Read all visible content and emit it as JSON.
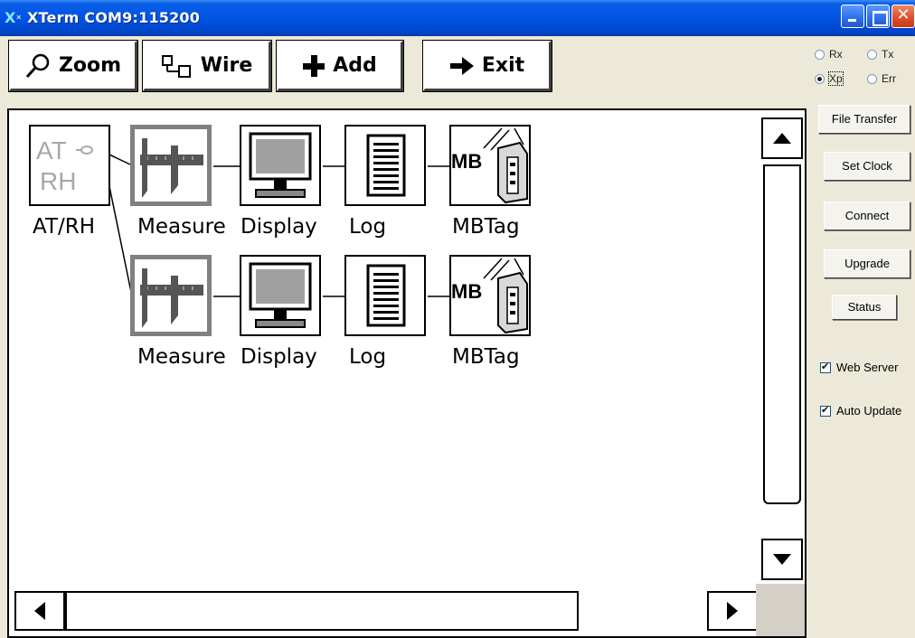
{
  "window": {
    "title": "XTerm COM9:115200",
    "icon": "xterm-icon",
    "icon_glyph": "X",
    "icon_sub": "✕",
    "close_glyph": "✕"
  },
  "toolbar": {
    "zoom_label": "Zoom",
    "wire_label": "Wire",
    "add_label": "Add",
    "exit_label": "Exit"
  },
  "diagram": {
    "source": {
      "label": "AT/RH",
      "icon_line1": "AT",
      "icon_line2": "RH"
    },
    "rows": [
      {
        "nodes": [
          {
            "label": "Measure",
            "icon": "caliper-icon",
            "selected": true
          },
          {
            "label": "Display",
            "icon": "monitor-icon",
            "selected": false
          },
          {
            "label": "Log",
            "icon": "log-icon",
            "selected": false
          },
          {
            "label": "MBTag",
            "icon": "mbtag-icon",
            "selected": false
          }
        ]
      },
      {
        "nodes": [
          {
            "label": "Measure",
            "icon": "caliper-icon",
            "selected": true
          },
          {
            "label": "Display",
            "icon": "monitor-icon",
            "selected": false
          },
          {
            "label": "Log",
            "icon": "log-icon",
            "selected": false
          },
          {
            "label": "MBTag",
            "icon": "mbtag-icon",
            "selected": false
          }
        ]
      }
    ],
    "mb_text": "MB"
  },
  "side": {
    "radios": [
      {
        "label": "Rx",
        "checked": false
      },
      {
        "label": "Tx",
        "checked": false
      },
      {
        "label": "Xp",
        "checked": true
      },
      {
        "label": "Err",
        "checked": false
      }
    ],
    "buttons": {
      "file_transfer": "File Transfer",
      "set_clock": "Set Clock",
      "connect": "Connect",
      "upgrade": "Upgrade",
      "status": "Status"
    },
    "checkboxes": {
      "web_server": {
        "label": "Web Server",
        "checked": true
      },
      "auto_update": {
        "label": "Auto Update",
        "checked": true
      }
    }
  }
}
